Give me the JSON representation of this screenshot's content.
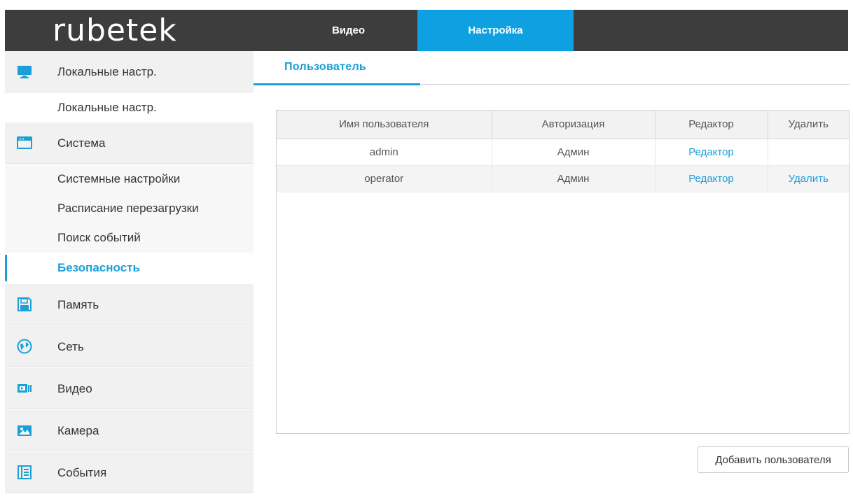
{
  "header": {
    "logo": "rubetek",
    "tabs": [
      {
        "label": "Видео"
      },
      {
        "label": "Настройка"
      }
    ]
  },
  "sidebar": {
    "groups": [
      {
        "label": "Локальные настр.",
        "icon": "monitor-icon"
      },
      {
        "label": "Система",
        "icon": "window-icon"
      },
      {
        "label": "Память",
        "icon": "floppy-icon"
      },
      {
        "label": "Сеть",
        "icon": "globe-icon"
      },
      {
        "label": "Видео",
        "icon": "video-icon"
      },
      {
        "label": "Камера",
        "icon": "image-icon"
      },
      {
        "label": "События",
        "icon": "list-icon"
      }
    ],
    "local_sub": [
      "Локальные настр."
    ],
    "system_sub": [
      "Системные настройки",
      "Расписание перезагрузки",
      "Поиск событий",
      "Безопасность"
    ]
  },
  "content": {
    "subtab": "Пользователь",
    "table": {
      "headers": [
        "Имя пользователя",
        "Авторизация",
        "Редактор",
        "Удалить"
      ],
      "rows": [
        {
          "name": "admin",
          "auth": "Админ",
          "edit": "Редактор",
          "delete": ""
        },
        {
          "name": "operator",
          "auth": "Админ",
          "edit": "Редактор",
          "delete": "Удалить"
        }
      ]
    },
    "add_button": "Добавить пользователя"
  },
  "colors": {
    "accent": "#1a9fd6",
    "topbar": "#3d3d3d",
    "active_tab": "#0ea0e0"
  }
}
